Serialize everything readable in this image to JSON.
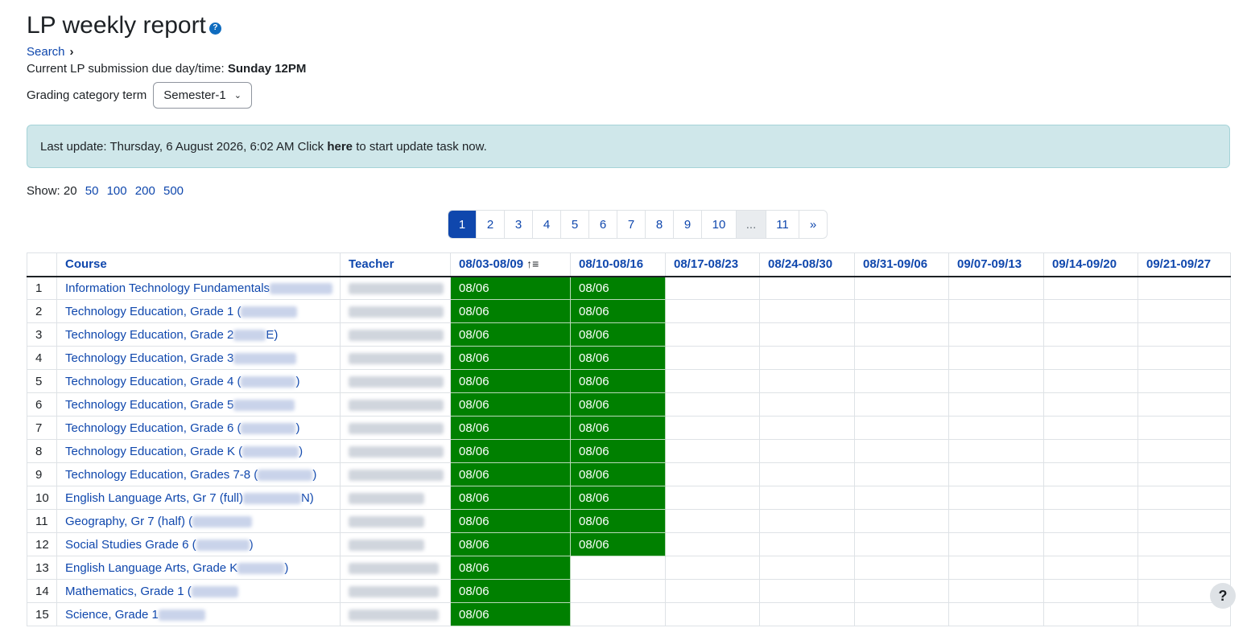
{
  "header": {
    "title": "LP weekly report"
  },
  "search": {
    "label": "Search"
  },
  "due": {
    "label": "Current LP submission due day/time:",
    "value": "Sunday 12PM"
  },
  "term": {
    "label": "Grading category term",
    "value": "Semester-1"
  },
  "alert": {
    "prefix": "Last update: Thursday, 6 August 2026, 6:02 AM Click",
    "link": "here",
    "suffix": "to start update task now."
  },
  "show": {
    "label": "Show:",
    "current": "20",
    "options": [
      "50",
      "100",
      "200",
      "500"
    ]
  },
  "pagination": [
    "1",
    "2",
    "3",
    "4",
    "5",
    "6",
    "7",
    "8",
    "9",
    "10",
    "...",
    "11",
    "»"
  ],
  "columns": [
    "",
    "Course",
    "Teacher",
    "08/03-08/09",
    "08/10-08/16",
    "08/17-08/23",
    "08/24-08/30",
    "08/31-09/06",
    "09/07-09/13",
    "09/14-09/20",
    "09/21-09/27"
  ],
  "rows": [
    {
      "n": "1",
      "course": "Information Technology Fundamentals",
      "suffix": "",
      "w1": "08/06",
      "w2": "08/06"
    },
    {
      "n": "2",
      "course": "Technology Education, Grade 1 (",
      "suffix": "",
      "w1": "08/06",
      "w2": "08/06"
    },
    {
      "n": "3",
      "course": "Technology Education, Grade 2",
      "suffix": "E)",
      "w1": "08/06",
      "w2": "08/06"
    },
    {
      "n": "4",
      "course": "Technology Education, Grade 3",
      "suffix": "",
      "w1": "08/06",
      "w2": "08/06"
    },
    {
      "n": "5",
      "course": "Technology Education, Grade 4 (",
      "suffix": ")",
      "w1": "08/06",
      "w2": "08/06"
    },
    {
      "n": "6",
      "course": "Technology Education, Grade 5",
      "suffix": "",
      "w1": "08/06",
      "w2": "08/06"
    },
    {
      "n": "7",
      "course": "Technology Education, Grade 6 (",
      "suffix": ")",
      "w1": "08/06",
      "w2": "08/06"
    },
    {
      "n": "8",
      "course": "Technology Education, Grade K (",
      "suffix": ")",
      "w1": "08/06",
      "w2": "08/06"
    },
    {
      "n": "9",
      "course": "Technology Education, Grades 7-8 (",
      "suffix": ")",
      "w1": "08/06",
      "w2": "08/06"
    },
    {
      "n": "10",
      "course": "English Language Arts, Gr 7 (full)",
      "suffix": "N)",
      "w1": "08/06",
      "w2": "08/06"
    },
    {
      "n": "11",
      "course": "Geography, Gr 7 (half) (",
      "suffix": "",
      "w1": "08/06",
      "w2": "08/06"
    },
    {
      "n": "12",
      "course": "Social Studies Grade 6 (",
      "suffix": ")",
      "w1": "08/06",
      "w2": "08/06"
    },
    {
      "n": "13",
      "course": "English Language Arts, Grade K",
      "suffix": ")",
      "w1": "08/06",
      "w2": ""
    },
    {
      "n": "14",
      "course": "Mathematics, Grade 1 (",
      "suffix": "",
      "w1": "08/06",
      "w2": ""
    },
    {
      "n": "15",
      "course": "Science, Grade 1",
      "suffix": "",
      "w1": "08/06",
      "w2": ""
    }
  ],
  "help": {
    "label": "?"
  }
}
